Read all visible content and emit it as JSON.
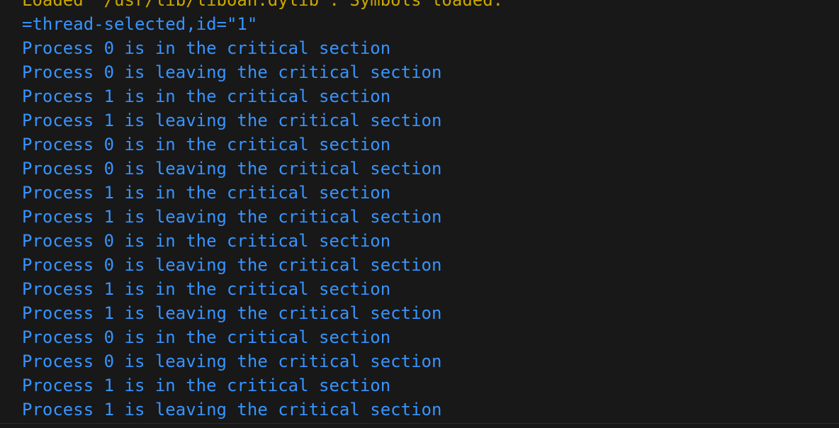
{
  "console": {
    "lines": [
      {
        "kind": "info",
        "text": "Loaded '/usr/lib/liboah.dylib'. Symbols loaded."
      },
      {
        "kind": "mi",
        "text": "=thread-selected,id=\"1\""
      },
      {
        "kind": "out",
        "text": "Process 0 is in the critical section"
      },
      {
        "kind": "out",
        "text": "Process 0 is leaving the critical section"
      },
      {
        "kind": "out",
        "text": "Process 1 is in the critical section"
      },
      {
        "kind": "out",
        "text": "Process 1 is leaving the critical section"
      },
      {
        "kind": "out",
        "text": "Process 0 is in the critical section"
      },
      {
        "kind": "out",
        "text": "Process 0 is leaving the critical section"
      },
      {
        "kind": "out",
        "text": "Process 1 is in the critical section"
      },
      {
        "kind": "out",
        "text": "Process 1 is leaving the critical section"
      },
      {
        "kind": "out",
        "text": "Process 0 is in the critical section"
      },
      {
        "kind": "out",
        "text": "Process 0 is leaving the critical section"
      },
      {
        "kind": "out",
        "text": "Process 1 is in the critical section"
      },
      {
        "kind": "out",
        "text": "Process 1 is leaving the critical section"
      },
      {
        "kind": "out",
        "text": "Process 0 is in the critical section"
      },
      {
        "kind": "out",
        "text": "Process 0 is leaving the critical section"
      },
      {
        "kind": "out",
        "text": "Process 1 is in the critical section"
      },
      {
        "kind": "out",
        "text": "Process 1 is leaving the critical section"
      }
    ]
  },
  "colors": {
    "background": "#181818",
    "info_text": "#cca700",
    "output_text": "#3794ff"
  }
}
